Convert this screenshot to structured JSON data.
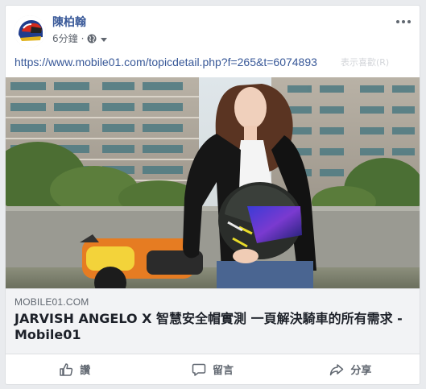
{
  "post": {
    "author": "陳柏翰",
    "time": "6分鐘",
    "text": "https://www.mobile01.com/topicdetail.php?f=265&t=6074893",
    "faded_overlay": "表示喜歡(R)"
  },
  "link": {
    "domain": "MOBILE01.COM",
    "title": "JARVISH ANGELO X 智慧安全帽實測 一頁解決騎車的所有需求 - Mobile01"
  },
  "actions": {
    "like": "讚",
    "comment": "留言",
    "share": "分享"
  },
  "colors": {
    "author": "#385898",
    "meta": "#616770",
    "link_bg": "#f2f3f5"
  }
}
